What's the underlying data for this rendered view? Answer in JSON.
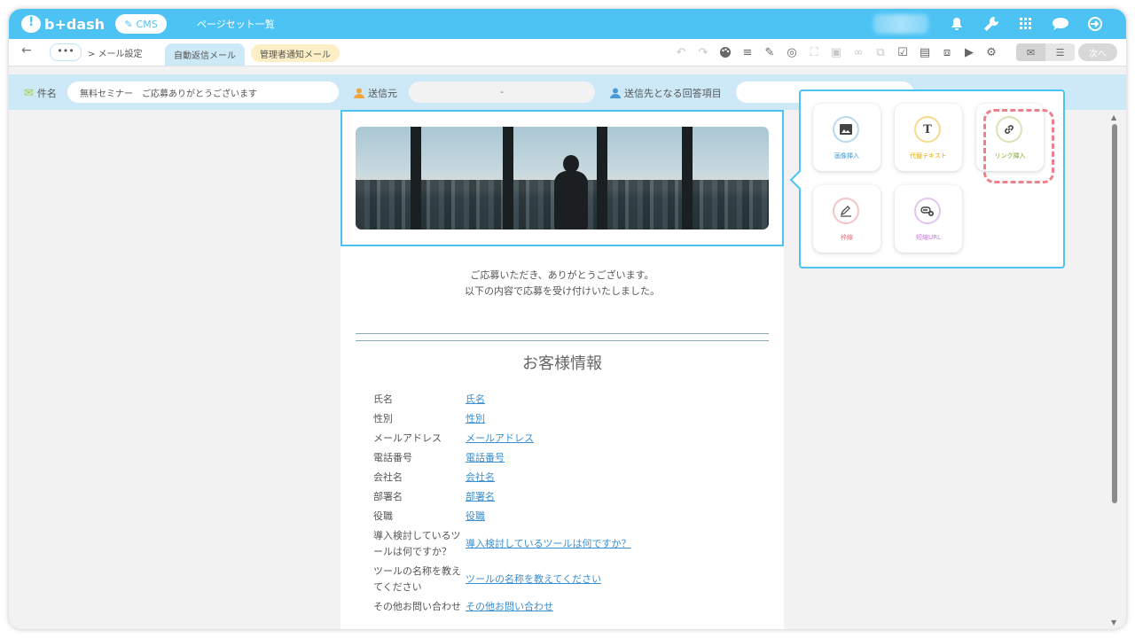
{
  "topbar": {
    "logo_text": "b+dash",
    "cms_label": "CMS",
    "nav_title": "ページセット一覧",
    "icons": [
      "bell-icon",
      "wrench-icon",
      "grid-icon",
      "chat-icon",
      "logout-icon"
    ]
  },
  "toolbar": {
    "dots_label": "•••",
    "breadcrumb": "> メール設定",
    "tab_auto_reply": "自動返信メール",
    "tab_admin_notify": "管理者通知メール",
    "next_label": "次へ"
  },
  "subject_row": {
    "subject_label": "件名",
    "subject_value": "無料セミナー　ご応募ありがとうございます",
    "sender_label": "送信元",
    "sender_value": "-",
    "recipient_label": "送信先となる回答項目",
    "recipient_value": "-"
  },
  "email": {
    "greeting_line1": "ご応募いただき、ありがとうございます。",
    "greeting_line2": "以下の内容で応募を受け付けいたしました。",
    "section_title": "お客様情報",
    "rows": [
      {
        "key": "氏名",
        "value": "氏名"
      },
      {
        "key": "性別",
        "value": "性別"
      },
      {
        "key": "メールアドレス",
        "value": "メールアドレス"
      },
      {
        "key": "電話番号",
        "value": "電話番号"
      },
      {
        "key": "会社名",
        "value": "会社名"
      },
      {
        "key": "部署名",
        "value": "部署名"
      },
      {
        "key": "役職",
        "value": "役職"
      },
      {
        "key": "導入検討しているツールは何ですか？",
        "value": "導入検討しているツールは何ですか？"
      },
      {
        "key": "ツールの名称を教えてください",
        "value": "ツールの名称を教えてください"
      },
      {
        "key": "その他お問い合わせ",
        "value": "その他お問い合わせ"
      }
    ]
  },
  "popover": {
    "items": [
      {
        "label": "画像挿入",
        "icon": "image-icon",
        "color": "#3a9ad9"
      },
      {
        "label": "代替テキスト",
        "icon": "text-icon",
        "color": "#e6a800"
      },
      {
        "label": "リンク挿入",
        "icon": "link-icon",
        "color": "#7aa82c"
      },
      {
        "label": "枠線",
        "icon": "pen-icon",
        "color": "#e8707a"
      },
      {
        "label": "短縮URL",
        "icon": "short-url-icon",
        "color": "#c27ad6"
      }
    ]
  },
  "colors": {
    "brand": "#4dc3f4",
    "tab_active": "#cde9f8",
    "tab_inactive": "#fcefc6",
    "highlight": "#ef7f8a"
  }
}
